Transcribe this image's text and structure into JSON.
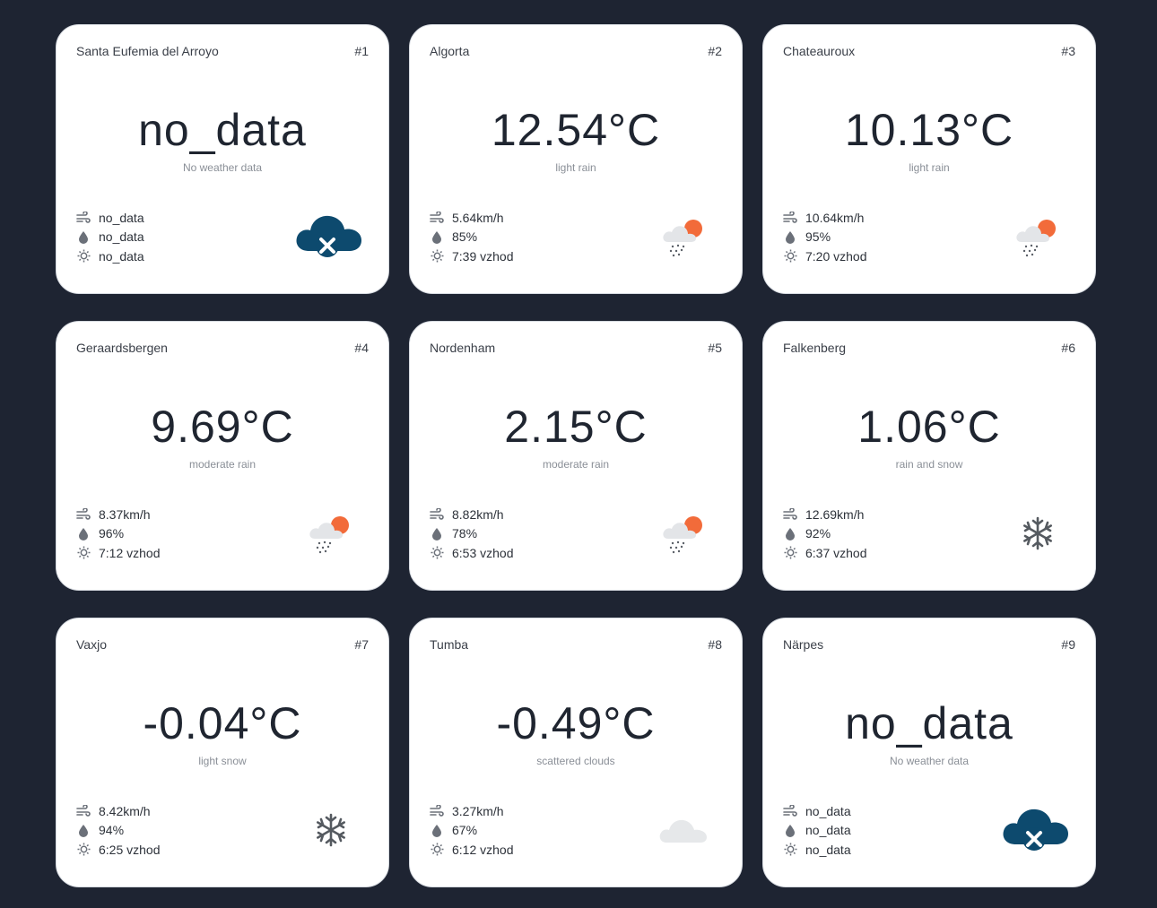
{
  "cards": [
    {
      "index": "#1",
      "city": "Santa Eufemia del Arroyo",
      "temp": "no_data",
      "desc": "No weather data",
      "wind": "no_data",
      "humidity": "no_data",
      "sunrise": "no_data",
      "icon": "cloud-error-icon"
    },
    {
      "index": "#2",
      "city": "Algorta",
      "temp": "12.54°C",
      "desc": "light rain",
      "wind": "5.64km/h",
      "humidity": "85%",
      "sunrise": "7:39 vzhod",
      "icon": "sun-cloud-rain-icon"
    },
    {
      "index": "#3",
      "city": "Chateauroux",
      "temp": "10.13°C",
      "desc": "light rain",
      "wind": "10.64km/h",
      "humidity": "95%",
      "sunrise": "7:20 vzhod",
      "icon": "sun-cloud-rain-icon"
    },
    {
      "index": "#4",
      "city": "Geraardsbergen",
      "temp": "9.69°C",
      "desc": "moderate rain",
      "wind": "8.37km/h",
      "humidity": "96%",
      "sunrise": "7:12 vzhod",
      "icon": "sun-cloud-rain-icon"
    },
    {
      "index": "#5",
      "city": "Nordenham",
      "temp": "2.15°C",
      "desc": "moderate rain",
      "wind": "8.82km/h",
      "humidity": "78%",
      "sunrise": "6:53 vzhod",
      "icon": "sun-cloud-rain-icon"
    },
    {
      "index": "#6",
      "city": "Falkenberg",
      "temp": "1.06°C",
      "desc": "rain and snow",
      "wind": "12.69km/h",
      "humidity": "92%",
      "sunrise": "6:37 vzhod",
      "icon": "snowflake-icon"
    },
    {
      "index": "#7",
      "city": "Vaxjo",
      "temp": "-0.04°C",
      "desc": "light snow",
      "wind": "8.42km/h",
      "humidity": "94%",
      "sunrise": "6:25 vzhod",
      "icon": "snowflake-icon"
    },
    {
      "index": "#8",
      "city": "Tumba",
      "temp": "-0.49°C",
      "desc": "scattered clouds",
      "wind": "3.27km/h",
      "humidity": "67%",
      "sunrise": "6:12 vzhod",
      "icon": "cloud-icon"
    },
    {
      "index": "#9",
      "city": "Närpes",
      "temp": "no_data",
      "desc": "No weather data",
      "wind": "no_data",
      "humidity": "no_data",
      "sunrise": "no_data",
      "icon": "cloud-error-icon"
    }
  ],
  "stat_icons": {
    "wind": "wind-icon",
    "humidity": "droplet-icon",
    "sunrise": "sun-icon"
  },
  "colors": {
    "background": "#1e2432",
    "card": "#ffffff",
    "error_cloud": "#0d4a6e",
    "sun": "#f26b3a",
    "cloud": "#e6e8ea",
    "snowflake": "#555a60"
  }
}
